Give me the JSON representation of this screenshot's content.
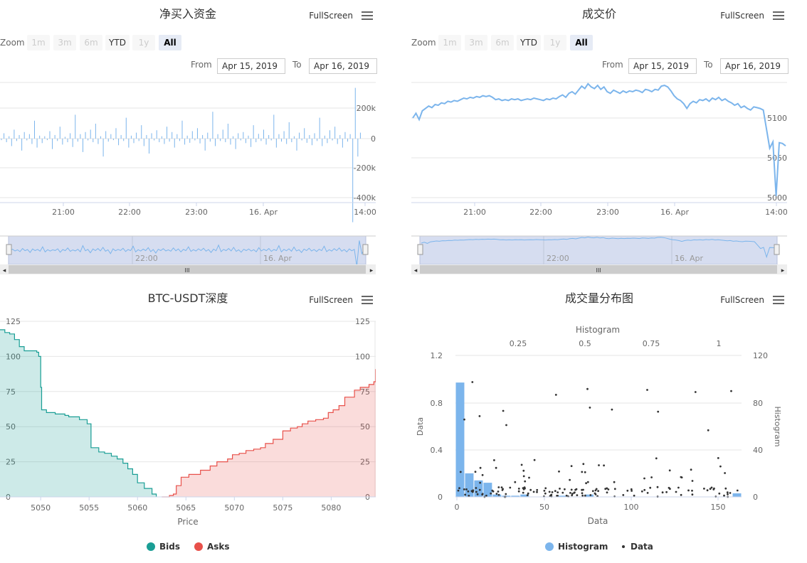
{
  "ui": {
    "fullscreen_label": "FullScreen",
    "zoom_label": "Zoom",
    "zoom_buttons": [
      "1m",
      "3m",
      "6m",
      "YTD",
      "1y",
      "All"
    ],
    "from_label": "From",
    "to_label": "To",
    "from_value": "Apr 15, 2019",
    "to_value": "Apr 16, 2019",
    "navigator_labels": [
      "22:00",
      "16. Apr"
    ],
    "navigator_scroll_grip": "III"
  },
  "chart_data": [
    {
      "type": "bar",
      "title": "净买入资金",
      "x_ticks": [
        "21:00",
        "22:00",
        "23:00",
        "16. Apr",
        "14:00"
      ],
      "y_ticks": [
        "200k",
        "0",
        "-200k",
        "-400k"
      ],
      "ylim": [
        -400000,
        200000
      ],
      "y_axis_side": "right",
      "values_k": [
        -5,
        18,
        -12,
        8,
        -25,
        30,
        -8,
        12,
        -40,
        22,
        -6,
        15,
        -18,
        60,
        -30,
        10,
        -15,
        8,
        -5,
        25,
        -35,
        12,
        -8,
        40,
        -20,
        6,
        -12,
        18,
        -28,
        80,
        -10,
        15,
        -45,
        22,
        -6,
        30,
        -12,
        50,
        -18,
        8,
        -60,
        25,
        -10,
        15,
        -5,
        35,
        -22,
        12,
        -8,
        70,
        -30,
        10,
        -15,
        20,
        -8,
        45,
        -25,
        12,
        -50,
        18,
        -6,
        28,
        -12,
        8,
        -18,
        40,
        -10,
        22,
        -30,
        15,
        -8,
        60,
        -20,
        10,
        -14,
        25,
        -6,
        35,
        -16,
        12,
        -40,
        20,
        -10,
        90,
        -25,
        15,
        -8,
        30,
        -12,
        50,
        -20,
        8,
        -35,
        18,
        -6,
        22,
        -15,
        10,
        -28,
        45,
        -12,
        16,
        -8,
        30,
        -20,
        12,
        -6,
        80,
        -30,
        15,
        -10,
        25,
        -18,
        55,
        -12,
        8,
        -40,
        20,
        -6,
        35,
        -14,
        12,
        -22,
        18,
        -8,
        70,
        -25,
        10,
        -15,
        28,
        -6,
        40,
        -18,
        12,
        -30,
        22,
        -10,
        15,
        -280,
        170,
        -60,
        20
      ]
    },
    {
      "type": "line",
      "title": "成交价",
      "x_ticks": [
        "21:00",
        "22:00",
        "23:00",
        "16. Apr",
        "14:00"
      ],
      "y_ticks": [
        "5100",
        "5050",
        "5000"
      ],
      "ylim": [
        5000,
        5100
      ],
      "y_axis_side": "right",
      "values": [
        5100,
        5106,
        5098,
        5109,
        5112,
        5115,
        5113,
        5117,
        5116,
        5119,
        5118,
        5121,
        5120,
        5122,
        5121,
        5123,
        5125,
        5124,
        5126,
        5125,
        5127,
        5126,
        5128,
        5127,
        5128,
        5126,
        5123,
        5124,
        5122,
        5123,
        5122,
        5124,
        5123,
        5124,
        5122,
        5123,
        5124,
        5123,
        5125,
        5124,
        5123,
        5122,
        5124,
        5123,
        5125,
        5124,
        5127,
        5129,
        5126,
        5131,
        5133,
        5130,
        5135,
        5140,
        5137,
        5143,
        5139,
        5137,
        5141,
        5136,
        5139,
        5133,
        5131,
        5135,
        5133,
        5131,
        5134,
        5132,
        5134,
        5133,
        5135,
        5134,
        5132,
        5136,
        5135,
        5133,
        5136,
        5135,
        5140,
        5141,
        5139,
        5134,
        5128,
        5124,
        5122,
        5118,
        5112,
        5118,
        5121,
        5119,
        5123,
        5122,
        5124,
        5121,
        5125,
        5123,
        5126,
        5122,
        5124,
        5121,
        5119,
        5116,
        5118,
        5113,
        5115,
        5112,
        5110,
        5114,
        5113,
        5112,
        5110,
        5086,
        5062,
        5070,
        5002,
        5069,
        5068,
        5065
      ]
    },
    {
      "type": "area",
      "title": "BTC-USDT深度",
      "xlabel": "Price",
      "x_ticks": [
        5050,
        5055,
        5060,
        5065,
        5070,
        5075,
        5080
      ],
      "y_ticks": [
        0,
        25,
        50,
        75,
        100,
        125
      ],
      "xlim": [
        5045.8,
        5084.6
      ],
      "ylim": [
        0,
        125
      ],
      "legend": "bottom",
      "series": [
        {
          "name": "Bids",
          "color": "#1a9e95",
          "x": [
            5045.8,
            5046.3,
            5046.8,
            5047.3,
            5047.8,
            5048.3,
            5049.6,
            5049.8,
            5050.0,
            5050.1,
            5050.6,
            5051.3,
            5051.5,
            5052.5,
            5052.9,
            5054.0,
            5054.8,
            5055.2,
            5056.0,
            5056.6,
            5057.3,
            5057.9,
            5058.5,
            5059.0,
            5059.5,
            5060.0,
            5060.7,
            5061.5
          ],
          "y": [
            119,
            117,
            116,
            112,
            107,
            104,
            103,
            100,
            78,
            62,
            60,
            60,
            59,
            58,
            57,
            55,
            52,
            35,
            32,
            31,
            29,
            27,
            24,
            20,
            16,
            10,
            6,
            2
          ]
        },
        {
          "name": "Asks",
          "color": "#e8504a",
          "x": [
            5062.5,
            5063.3,
            5063.7,
            5064.0,
            5064.5,
            5065.3,
            5066.5,
            5067.5,
            5068.2,
            5069.3,
            5069.8,
            5070.5,
            5071.2,
            5072.0,
            5072.7,
            5073.2,
            5074.0,
            5075.0,
            5075.8,
            5076.5,
            5077.0,
            5077.6,
            5078.4,
            5079.2,
            5079.7,
            5080.2,
            5080.8,
            5081.4,
            5082.4,
            5083.0,
            5083.9,
            5084.4,
            5084.6
          ],
          "y": [
            0,
            1,
            2,
            8,
            14,
            16,
            19,
            22,
            25,
            27,
            30,
            31,
            33,
            34,
            35,
            38,
            41,
            47,
            49,
            50,
            52,
            54,
            55,
            56,
            60,
            62,
            65,
            71,
            76,
            78,
            80,
            82,
            91
          ]
        }
      ]
    },
    {
      "type": "bar",
      "title": "成交量分布图",
      "subtitle_axis": "Histogram",
      "xlabel": "Data",
      "ylabel_left": "Data",
      "ylabel_right": "Histogram",
      "x_ticks": [
        0,
        50,
        100,
        150
      ],
      "top_x_ticks": [
        "0.25",
        "0.5",
        "0.75",
        "1"
      ],
      "left_y_ticks": [
        "0",
        "0.4",
        "0.8",
        "1.2"
      ],
      "right_y_ticks": [
        "0",
        "40",
        "80",
        "120"
      ],
      "legend": "bottom",
      "series": [
        {
          "name": "Histogram",
          "color": "#7cb5ec",
          "values": [
            97,
            20,
            14,
            12,
            2,
            1,
            1,
            2,
            0,
            0,
            0,
            1,
            0,
            0,
            2,
            0,
            0,
            0,
            0,
            0,
            0,
            0,
            0,
            0,
            0,
            0,
            0,
            0,
            0,
            0,
            3
          ]
        },
        {
          "name": "Data",
          "color": "#333333"
        }
      ]
    }
  ]
}
